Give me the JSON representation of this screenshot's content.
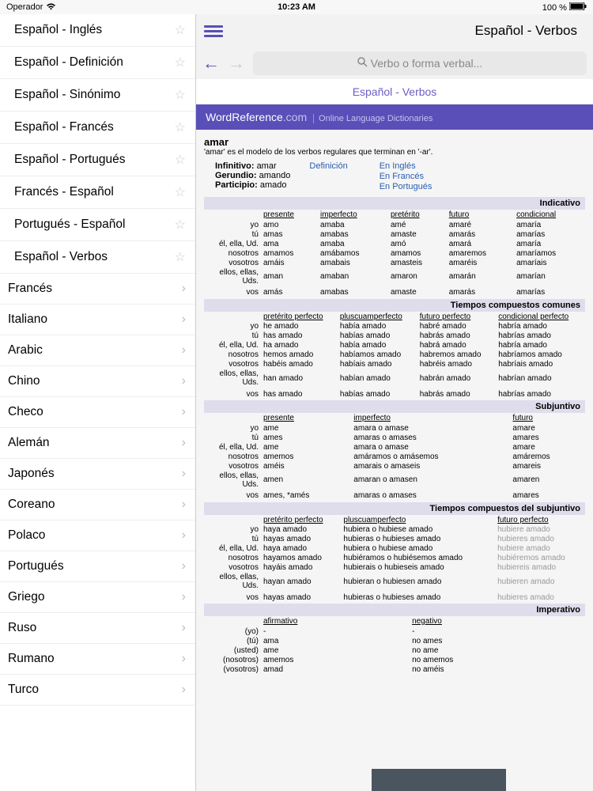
{
  "status": {
    "carrier": "Operador",
    "time": "10:23 AM",
    "battery": "100 %"
  },
  "sidebar": {
    "dicts": [
      "Español - Inglés",
      "Español - Definición",
      "Español - Sinónimo",
      "Español - Francés",
      "Español - Portugués",
      "Francés - Español",
      "Portugués - Español",
      "Español - Verbos"
    ],
    "langs": [
      "Francés",
      "Italiano",
      "Arabic",
      "Chino",
      "Checo",
      "Alemán",
      "Japonés",
      "Coreano",
      "Polaco",
      "Portugués",
      "Griego",
      "Ruso",
      "Rumano",
      "Turco"
    ]
  },
  "header": {
    "title": "Español - Verbos",
    "search_placeholder": "Verbo o forma verbal...",
    "breadcrumb": "Español - Verbos"
  },
  "banner": {
    "brand": "WordReference",
    "suffix": ".com",
    "tagline": "Online Language Dictionaries"
  },
  "verb": {
    "name": "amar",
    "note": "'amar' es el modelo de los verbos regulares que terminan en '-ar'.",
    "infinitivo_lbl": "Infinitivo:",
    "infinitivo": "amar",
    "gerundio_lbl": "Gerundio:",
    "gerundio": "amando",
    "participio_lbl": "Participio:",
    "participio": "amado",
    "links": [
      "Definición",
      "En Inglés",
      "En Francés",
      "En Portugués"
    ]
  },
  "pronouns": [
    "yo",
    "tú",
    "él, ella, Ud.",
    "nosotros",
    "vosotros",
    "ellos, ellas, Uds.",
    "vos"
  ],
  "imp_pronouns": [
    "(yo)",
    "(tú)",
    "(usted)",
    "(nosotros)",
    "(vosotros)"
  ],
  "sections": {
    "indicativo": {
      "title": "Indicativo",
      "tenses": [
        "presente",
        "imperfecto",
        "pretérito",
        "futuro",
        "condicional"
      ],
      "rows": [
        [
          "amo",
          "amaba",
          "amé",
          "amaré",
          "amaría"
        ],
        [
          "amas",
          "amabas",
          "amaste",
          "amarás",
          "amarías"
        ],
        [
          "ama",
          "amaba",
          "amó",
          "amará",
          "amaría"
        ],
        [
          "amamos",
          "amábamos",
          "amamos",
          "amaremos",
          "amaríamos"
        ],
        [
          "amáis",
          "amabais",
          "amasteis",
          "amaréis",
          "amaríais"
        ],
        [
          "aman",
          "amaban",
          "amaron",
          "amarán",
          "amarían"
        ],
        [
          "amás",
          "amabas",
          "amaste",
          "amarás",
          "amarías"
        ]
      ]
    },
    "compuestos": {
      "title": "Tiempos compuestos comunes",
      "tenses": [
        "pretérito perfecto",
        "pluscuamperfecto",
        "futuro perfecto",
        "condicional perfecto"
      ],
      "rows": [
        [
          "he amado",
          "había amado",
          "habré amado",
          "habría amado"
        ],
        [
          "has amado",
          "habías amado",
          "habrás amado",
          "habrías amado"
        ],
        [
          "ha amado",
          "había amado",
          "habrá amado",
          "habría amado"
        ],
        [
          "hemos amado",
          "habíamos amado",
          "habremos amado",
          "habríamos amado"
        ],
        [
          "habéis amado",
          "habíais amado",
          "habréis amado",
          "habríais amado"
        ],
        [
          "han amado",
          "habían amado",
          "habrán amado",
          "habrían amado"
        ],
        [
          "has amado",
          "habías amado",
          "habrás amado",
          "habrías amado"
        ]
      ]
    },
    "subjuntivo": {
      "title": "Subjuntivo",
      "tenses": [
        "presente",
        "imperfecto",
        "futuro"
      ],
      "rows": [
        [
          "ame",
          "amara o amase",
          "amare"
        ],
        [
          "ames",
          "amaras o amases",
          "amares"
        ],
        [
          "ame",
          "amara o amase",
          "amare"
        ],
        [
          "amemos",
          "amáramos o amásemos",
          "amáremos"
        ],
        [
          "améis",
          "amarais o amaseis",
          "amareis"
        ],
        [
          "amen",
          "amaran o amasen",
          "amaren"
        ],
        [
          "ames, *amés",
          "amaras o amases",
          "amares"
        ]
      ]
    },
    "comp_subj": {
      "title": "Tiempos compuestos del subjuntivo",
      "tenses": [
        "pretérito perfecto",
        "pluscuamperfecto",
        "futuro perfecto"
      ],
      "rows": [
        [
          "haya amado",
          "hubiera o hubiese amado",
          "hubiere amado"
        ],
        [
          "hayas amado",
          "hubieras o hubieses amado",
          "hubieres amado"
        ],
        [
          "haya amado",
          "hubiera o hubiese amado",
          "hubiere amado"
        ],
        [
          "hayamos amado",
          "hubiéramos o hubiésemos amado",
          "hubiéremos amado"
        ],
        [
          "hayáis amado",
          "hubierais o hubieseis amado",
          "hubiereis amado"
        ],
        [
          "hayan amado",
          "hubieran o hubiesen amado",
          "hubieren amado"
        ],
        [
          "hayas amado",
          "hubieras o hubieses amado",
          "hubieres amado"
        ]
      ]
    },
    "imperativo": {
      "title": "Imperativo",
      "tenses": [
        "afirmativo",
        "negativo"
      ],
      "rows": [
        [
          "-",
          "-"
        ],
        [
          "ama",
          "no ames"
        ],
        [
          "ame",
          "no ame"
        ],
        [
          "amemos",
          "no amemos"
        ],
        [
          "amad",
          "no améis"
        ]
      ]
    }
  }
}
